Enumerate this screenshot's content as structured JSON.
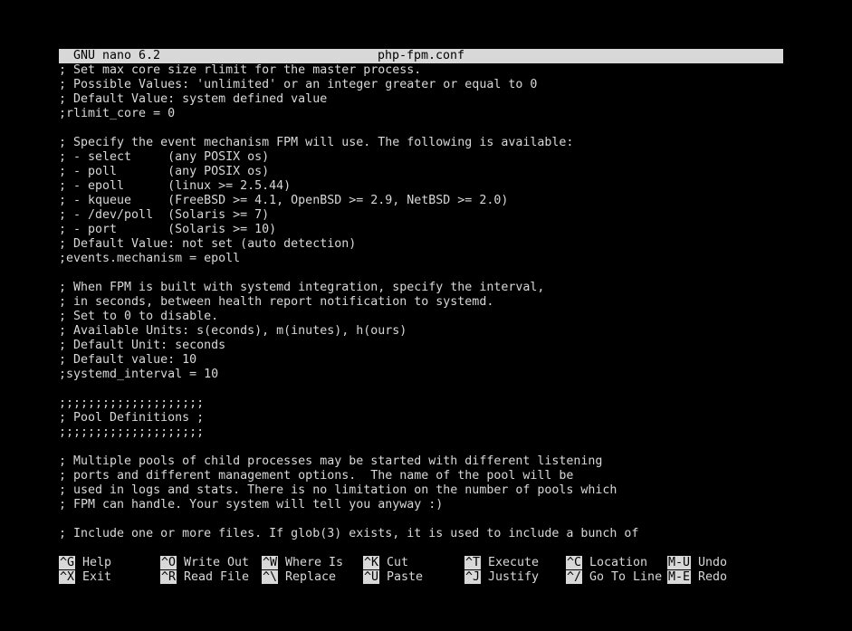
{
  "title_bar": {
    "app": "GNU nano 6.2",
    "filename": "php-fpm.conf"
  },
  "lines": [
    "; Set max core size rlimit for the master process.",
    "; Possible Values: 'unlimited' or an integer greater or equal to 0",
    "; Default Value: system defined value",
    ";rlimit_core = 0",
    "",
    "; Specify the event mechanism FPM will use. The following is available:",
    "; - select     (any POSIX os)",
    "; - poll       (any POSIX os)",
    "; - epoll      (linux >= 2.5.44)",
    "; - kqueue     (FreeBSD >= 4.1, OpenBSD >= 2.9, NetBSD >= 2.0)",
    "; - /dev/poll  (Solaris >= 7)",
    "; - port       (Solaris >= 10)",
    "; Default Value: not set (auto detection)",
    ";events.mechanism = epoll",
    "",
    "; When FPM is built with systemd integration, specify the interval,",
    "; in seconds, between health report notification to systemd.",
    "; Set to 0 to disable.",
    "; Available Units: s(econds), m(inutes), h(ours)",
    "; Default Unit: seconds",
    "; Default value: 10",
    ";systemd_interval = 10",
    "",
    ";;;;;;;;;;;;;;;;;;;;",
    "; Pool Definitions ;",
    ";;;;;;;;;;;;;;;;;;;;",
    "",
    "; Multiple pools of child processes may be started with different listening",
    "; ports and different management options.  The name of the pool will be",
    "; used in logs and stats. There is no limitation on the number of pools which",
    "; FPM can handle. Your system will tell you anyway :)",
    "",
    "; Include one or more files. If glob(3) exists, it is used to include a bunch of"
  ],
  "shortcuts": {
    "row1": [
      {
        "key": "^G",
        "label": "Help"
      },
      {
        "key": "^O",
        "label": "Write Out"
      },
      {
        "key": "^W",
        "label": "Where Is"
      },
      {
        "key": "^K",
        "label": "Cut"
      },
      {
        "key": "^T",
        "label": "Execute"
      },
      {
        "key": "^C",
        "label": "Location"
      },
      {
        "key": "M-U",
        "label": "Undo"
      }
    ],
    "row2": [
      {
        "key": "^X",
        "label": "Exit"
      },
      {
        "key": "^R",
        "label": "Read File"
      },
      {
        "key": "^\\",
        "label": "Replace"
      },
      {
        "key": "^U",
        "label": "Paste"
      },
      {
        "key": "^J",
        "label": "Justify"
      },
      {
        "key": "^/",
        "label": "Go To Line"
      },
      {
        "key": "M-E",
        "label": "Redo"
      }
    ]
  }
}
